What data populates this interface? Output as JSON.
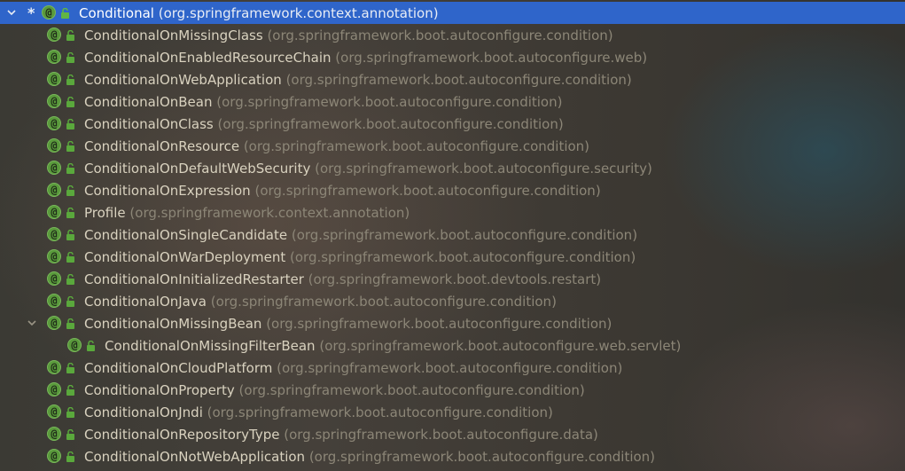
{
  "tree": {
    "root": {
      "name": "Conditional",
      "package": "(org.springframework.context.annotation)",
      "marker": "*"
    },
    "items": [
      {
        "name": "ConditionalOnMissingClass",
        "package": "(org.springframework.boot.autoconfigure.condition)"
      },
      {
        "name": "ConditionalOnEnabledResourceChain",
        "package": "(org.springframework.boot.autoconfigure.web)"
      },
      {
        "name": "ConditionalOnWebApplication",
        "package": "(org.springframework.boot.autoconfigure.condition)"
      },
      {
        "name": "ConditionalOnBean",
        "package": "(org.springframework.boot.autoconfigure.condition)"
      },
      {
        "name": "ConditionalOnClass",
        "package": "(org.springframework.boot.autoconfigure.condition)"
      },
      {
        "name": "ConditionalOnResource",
        "package": "(org.springframework.boot.autoconfigure.condition)"
      },
      {
        "name": "ConditionalOnDefaultWebSecurity",
        "package": "(org.springframework.boot.autoconfigure.security)"
      },
      {
        "name": "ConditionalOnExpression",
        "package": "(org.springframework.boot.autoconfigure.condition)"
      },
      {
        "name": "Profile",
        "package": "(org.springframework.context.annotation)"
      },
      {
        "name": "ConditionalOnSingleCandidate",
        "package": "(org.springframework.boot.autoconfigure.condition)"
      },
      {
        "name": "ConditionalOnWarDeployment",
        "package": "(org.springframework.boot.autoconfigure.condition)"
      },
      {
        "name": "ConditionalOnInitializedRestarter",
        "package": "(org.springframework.boot.devtools.restart)"
      },
      {
        "name": "ConditionalOnJava",
        "package": "(org.springframework.boot.autoconfigure.condition)"
      },
      {
        "name": "ConditionalOnMissingBean",
        "package": "(org.springframework.boot.autoconfigure.condition)"
      },
      {
        "name": "ConditionalOnMissingFilterBean",
        "package": "(org.springframework.boot.autoconfigure.web.servlet)"
      },
      {
        "name": "ConditionalOnCloudPlatform",
        "package": "(org.springframework.boot.autoconfigure.condition)"
      },
      {
        "name": "ConditionalOnProperty",
        "package": "(org.springframework.boot.autoconfigure.condition)"
      },
      {
        "name": "ConditionalOnJndi",
        "package": "(org.springframework.boot.autoconfigure.condition)"
      },
      {
        "name": "ConditionalOnRepositoryType",
        "package": "(org.springframework.boot.autoconfigure.data)"
      },
      {
        "name": "ConditionalOnNotWebApplication",
        "package": "(org.springframework.boot.autoconfigure.condition)"
      }
    ],
    "icons": {
      "annotation": "annotation-icon",
      "access": "public-lock-icon",
      "expand": "chevron-down-icon",
      "annotation_glyph": "@"
    },
    "colors": {
      "selection": "#2f65ca",
      "annotation_green": "#5a9a3c",
      "name_text": "#d9d2bf",
      "package_text": "#8c8677"
    }
  }
}
